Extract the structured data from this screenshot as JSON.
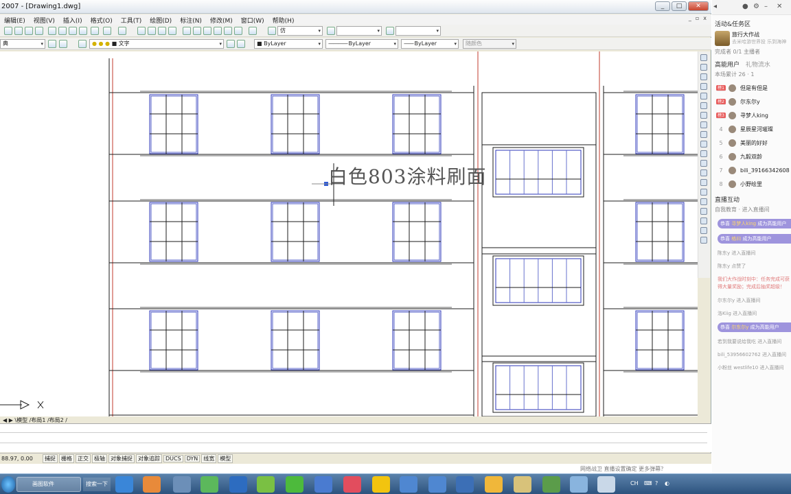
{
  "window": {
    "title": "2007 - [Drawing1.dwg]",
    "controls": [
      "_",
      "□",
      "✕"
    ]
  },
  "menu": [
    "编辑(E)",
    "视图(V)",
    "插入(I)",
    "格式(O)",
    "工具(T)",
    "绘图(D)",
    "标注(N)",
    "修改(M)",
    "窗口(W)",
    "帮助(H)"
  ],
  "toolbar": {
    "text_style_combo": "仿",
    "workspace_combo": "典",
    "layer_combo": "文字",
    "color_combo": "ByLayer",
    "linetype_combo": "ByLayer",
    "lineweight_combo": "ByLayer",
    "plotstyle_combo": "随颜色"
  },
  "drawing": {
    "annotation": "白色803涂料刷面"
  },
  "layout_tabs": {
    "text": "◀ ▶ \\模型 /布局1 /布局2 /"
  },
  "status": {
    "coordinates": "88.97, 0.00",
    "toggles": [
      "捕捉",
      "栅格",
      "正交",
      "极轴",
      "对象捕捉",
      "对象追踪",
      "DUCS",
      "DYN",
      "线宽",
      "模型"
    ]
  },
  "stream_overlay": {
    "footer_text": "网络战卫    直播设置确定    更多弹幕？"
  },
  "panel": {
    "header_icons": [
      "avatar",
      "gear-icon",
      "minimize",
      "close"
    ],
    "activity_title": "活动&任务区",
    "game_title": "旅行大作战",
    "game_sub": "去米哈游世界投 乐到海神",
    "task_row": "完成者 0/1  主播者",
    "highenergy_title": "高能用户",
    "gift_tab": "礼物流水",
    "room_info": "本场累计 26 · 1",
    "ranking": [
      {
        "rank": "榜1",
        "name": "但是有但是"
      },
      {
        "rank": "榜2",
        "name": "尔东尔y"
      },
      {
        "rank": "榜3",
        "name": "寻梦人king"
      },
      {
        "rank": "4",
        "name": "星辰星河璀璨"
      },
      {
        "rank": "5",
        "name": "美丽的好好"
      },
      {
        "rank": "6",
        "name": "九毅双龄"
      },
      {
        "rank": "7",
        "name": "bili_39166342608"
      },
      {
        "rank": "8",
        "name": "小野绘里"
      }
    ],
    "interact_title": "直播互动",
    "interact_sub": "自我教育 · 进入直播间",
    "chat": [
      {
        "type": "pill",
        "prefix": "恭喜",
        "user": "寻梦人king",
        "text": "成为高能用户"
      },
      {
        "type": "pill",
        "prefix": "恭喜",
        "user": "格曰",
        "text": "成为高能用户"
      },
      {
        "type": "msg",
        "text": "陈东y 进入直播间"
      },
      {
        "type": "msg",
        "text": "陈东y 点赞了"
      },
      {
        "type": "warn",
        "text": "我们大作战时刻中：任务完成可获得大量奖励；完成后抽奖超级！"
      },
      {
        "type": "msg",
        "text": "尔东尔y 进入直播间"
      },
      {
        "type": "msg",
        "text": "洛Kiig 进入直播间"
      },
      {
        "type": "pill",
        "prefix": "恭喜",
        "user": "尔东尔y",
        "text": "成为高能用户"
      },
      {
        "type": "msg",
        "text": "若到我要说给我吃 进入直播间"
      },
      {
        "type": "msg",
        "text": "bili_53956602762 进入直播间"
      },
      {
        "type": "msg",
        "text": "小粉丝 westlife10 进入直播间"
      }
    ]
  },
  "taskbar": {
    "task1": "画图软件",
    "search": "搜索一下",
    "tray": [
      "CH",
      "⌨",
      "?",
      "◐"
    ]
  },
  "colors": {
    "window_blue": "#3b5f8c",
    "drawing_line": "#1b1b1b",
    "window_frame": "#2b36b8",
    "accent_red": "#c0392b",
    "pill": "#9e94dd"
  }
}
